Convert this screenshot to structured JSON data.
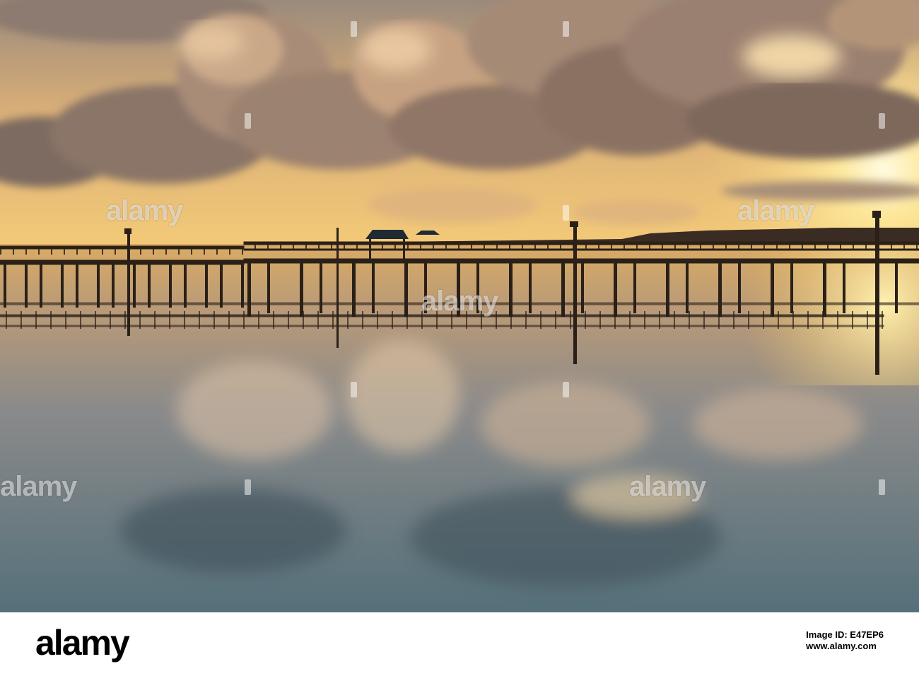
{
  "photo": {
    "subject": "sunset-over-water-with-piers",
    "colors": {
      "sky_top": "#8a7c74",
      "sky_glow": "#f2c66a",
      "sun": "#fff4c8",
      "cloud_dark": "#6b5a52",
      "cloud_light": "#d9b38c",
      "water_top": "#c8a46e",
      "water_bottom": "#4f6a72",
      "pier": "#2a2018"
    }
  },
  "watermarks": [
    {
      "text": "alamy"
    },
    {
      "text": "alamy"
    },
    {
      "text": "alamy"
    },
    {
      "text": "alamy"
    },
    {
      "text": "alamy"
    },
    {
      "text": "alamy"
    }
  ],
  "footer": {
    "logo": "alamy",
    "id_label": "Image ID: E47EP6",
    "site": "www.alamy.com"
  }
}
